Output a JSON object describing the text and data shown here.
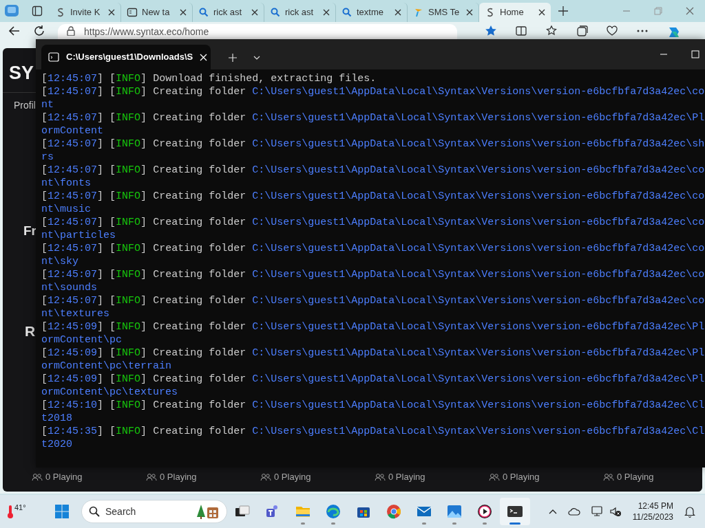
{
  "browser": {
    "tabs": [
      {
        "label": "Invite K",
        "kind": "logo",
        "selected": false
      },
      {
        "label": "New ta",
        "kind": "newtab",
        "selected": false
      },
      {
        "label": "rick ast",
        "kind": "search",
        "selected": false
      },
      {
        "label": "rick ast",
        "kind": "search",
        "selected": false
      },
      {
        "label": "textme",
        "kind": "search",
        "selected": false
      },
      {
        "label": "SMS Te",
        "kind": "flag",
        "selected": false
      },
      {
        "label": "Home",
        "kind": "logo",
        "selected": true
      }
    ],
    "address": "https://www.syntax.eco/home",
    "page": {
      "logo": "SY",
      "nav_item": "Profil",
      "headings": [
        "Fr",
        "R"
      ],
      "servers": [
        {
          "players": "0 Playing"
        },
        {
          "players": "0 Playing"
        },
        {
          "players": "0 Playing"
        },
        {
          "players": "0 Playing"
        },
        {
          "players": "0 Playing"
        },
        {
          "players": "0 Playing"
        }
      ]
    }
  },
  "terminal": {
    "tab_title": "C:\\Users\\guest1\\Downloads\\S",
    "entries": [
      {
        "time": "[12:45:07]",
        "level": "[INFO]",
        "message": "Download finished, extracting files."
      },
      {
        "time": "[12:45:07]",
        "level": "[INFO]",
        "message": "Creating folder",
        "path": "C:\\Users\\guest1\\AppData\\Local\\Syntax\\Versions\\version-e6bcfbfa7d3a42ec\\co",
        "path_wrap": "nt"
      },
      {
        "time": "[12:45:07]",
        "level": "[INFO]",
        "message": "Creating folder",
        "path": "C:\\Users\\guest1\\AppData\\Local\\Syntax\\Versions\\version-e6bcfbfa7d3a42ec\\Pl",
        "path_wrap": "ormContent"
      },
      {
        "time": "[12:45:07]",
        "level": "[INFO]",
        "message": "Creating folder",
        "path": "C:\\Users\\guest1\\AppData\\Local\\Syntax\\Versions\\version-e6bcfbfa7d3a42ec\\sh",
        "path_wrap": "rs"
      },
      {
        "time": "[12:45:07]",
        "level": "[INFO]",
        "message": "Creating folder",
        "path": "C:\\Users\\guest1\\AppData\\Local\\Syntax\\Versions\\version-e6bcfbfa7d3a42ec\\co",
        "path_wrap": "nt\\fonts"
      },
      {
        "time": "[12:45:07]",
        "level": "[INFO]",
        "message": "Creating folder",
        "path": "C:\\Users\\guest1\\AppData\\Local\\Syntax\\Versions\\version-e6bcfbfa7d3a42ec\\co",
        "path_wrap": "nt\\music"
      },
      {
        "time": "[12:45:07]",
        "level": "[INFO]",
        "message": "Creating folder",
        "path": "C:\\Users\\guest1\\AppData\\Local\\Syntax\\Versions\\version-e6bcfbfa7d3a42ec\\co",
        "path_wrap": "nt\\particles"
      },
      {
        "time": "[12:45:07]",
        "level": "[INFO]",
        "message": "Creating folder",
        "path": "C:\\Users\\guest1\\AppData\\Local\\Syntax\\Versions\\version-e6bcfbfa7d3a42ec\\co",
        "path_wrap": "nt\\sky"
      },
      {
        "time": "[12:45:07]",
        "level": "[INFO]",
        "message": "Creating folder",
        "path": "C:\\Users\\guest1\\AppData\\Local\\Syntax\\Versions\\version-e6bcfbfa7d3a42ec\\co",
        "path_wrap": "nt\\sounds"
      },
      {
        "time": "[12:45:07]",
        "level": "[INFO]",
        "message": "Creating folder",
        "path": "C:\\Users\\guest1\\AppData\\Local\\Syntax\\Versions\\version-e6bcfbfa7d3a42ec\\co",
        "path_wrap": "nt\\textures"
      },
      {
        "time": "[12:45:09]",
        "level": "[INFO]",
        "message": "Creating folder",
        "path": "C:\\Users\\guest1\\AppData\\Local\\Syntax\\Versions\\version-e6bcfbfa7d3a42ec\\Pl",
        "path_wrap": "ormContent\\pc"
      },
      {
        "time": "[12:45:09]",
        "level": "[INFO]",
        "message": "Creating folder",
        "path": "C:\\Users\\guest1\\AppData\\Local\\Syntax\\Versions\\version-e6bcfbfa7d3a42ec\\Pl",
        "path_wrap": "ormContent\\pc\\terrain"
      },
      {
        "time": "[12:45:09]",
        "level": "[INFO]",
        "message": "Creating folder",
        "path": "C:\\Users\\guest1\\AppData\\Local\\Syntax\\Versions\\version-e6bcfbfa7d3a42ec\\Pl",
        "path_wrap": "ormContent\\pc\\textures"
      },
      {
        "time": "[12:45:10]",
        "level": "[INFO]",
        "message": "Creating folder",
        "path": "C:\\Users\\guest1\\AppData\\Local\\Syntax\\Versions\\version-e6bcfbfa7d3a42ec\\Cl",
        "path_wrap": "t2018"
      },
      {
        "time": "[12:45:35]",
        "level": "[INFO]",
        "message": "Creating folder",
        "path": "C:\\Users\\guest1\\AppData\\Local\\Syntax\\Versions\\version-e6bcfbfa7d3a42ec\\Cl",
        "path_wrap": "t2020"
      }
    ]
  },
  "taskbar": {
    "weather": "41°",
    "search_placeholder": "Search",
    "apps": [
      {
        "kind": "taskview",
        "running": false,
        "active": false
      },
      {
        "kind": "teams",
        "running": false,
        "active": false
      },
      {
        "kind": "explorer",
        "running": true,
        "active": false
      },
      {
        "kind": "edge",
        "running": true,
        "active": false
      },
      {
        "kind": "store",
        "running": false,
        "active": false
      },
      {
        "kind": "chrome",
        "running": false,
        "active": false
      },
      {
        "kind": "mail",
        "running": true,
        "active": false
      },
      {
        "kind": "photos",
        "running": true,
        "active": false
      },
      {
        "kind": "player",
        "running": true,
        "active": false
      },
      {
        "kind": "terminal",
        "running": true,
        "active": true
      }
    ],
    "time": "12:45 PM",
    "date": "11/25/2023"
  }
}
